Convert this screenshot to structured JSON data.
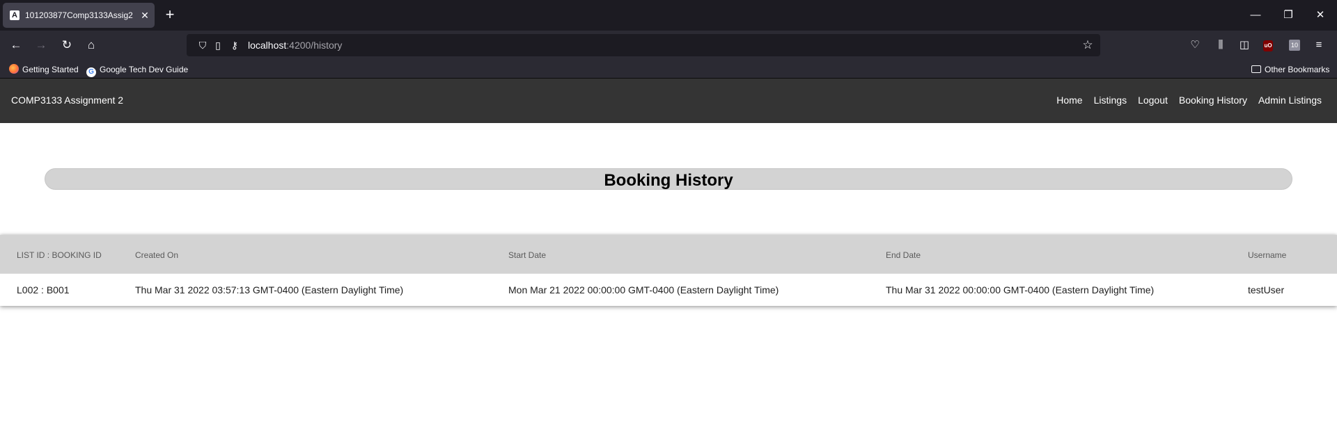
{
  "browser": {
    "tab_title": "101203877Comp3133Assig2",
    "tab_favicon": "A",
    "url_host": "localhost",
    "url_path": ":4200/history",
    "bookmarks": [
      {
        "label": "Getting Started",
        "icon": "firefox-icon"
      },
      {
        "label": "Google Tech Dev Guide",
        "icon": "google-icon"
      }
    ],
    "other_bookmarks": "Other Bookmarks",
    "toolbar_badge": "10"
  },
  "app": {
    "brand": "COMP3133 Assignment 2",
    "nav": [
      "Home",
      "Listings",
      "Logout",
      "Booking History",
      "Admin Listings"
    ]
  },
  "page": {
    "heading": "Booking History"
  },
  "table": {
    "headers": [
      "LIST ID : BOOKING ID",
      "Created On",
      "Start Date",
      "End Date",
      "Username"
    ],
    "rows": [
      [
        "L002 : B001",
        "Thu Mar 31 2022 03:57:13 GMT-0400 (Eastern Daylight Time)",
        "Mon Mar 21 2022 00:00:00 GMT-0400 (Eastern Daylight Time)",
        "Thu Mar 31 2022 00:00:00 GMT-0400 (Eastern Daylight Time)",
        "testUser"
      ]
    ]
  },
  "colors": {
    "tabstrip": "#1c1b22",
    "toolbar": "#2b2a33",
    "app_nav": "#343434",
    "heading_bar": "#d3d3d3",
    "table_header": "#d3d3d3"
  }
}
